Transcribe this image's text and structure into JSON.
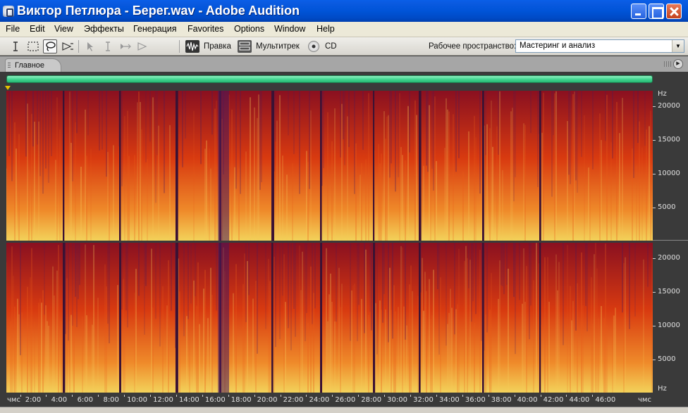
{
  "window": {
    "title": "Виктор Петлюра - Берег.wav - Adobe Audition",
    "app_icon": "adobe-audition-icon"
  },
  "menu": [
    {
      "label": "File"
    },
    {
      "label": "Edit"
    },
    {
      "label": "View"
    },
    {
      "label": "Эффекты"
    },
    {
      "label": "Генерация"
    },
    {
      "label": "Favorites"
    },
    {
      "label": "Options"
    },
    {
      "label": "Window"
    },
    {
      "label": "Help"
    }
  ],
  "toolbar": {
    "tools": [
      {
        "name": "time-selection-tool-icon",
        "selected": false
      },
      {
        "name": "marquee-selection-tool-icon",
        "selected": false
      },
      {
        "name": "lasso-selection-tool-icon",
        "selected": true
      },
      {
        "name": "effects-paintbrush-tool-icon",
        "selected": false
      },
      {
        "name": "move-tool-icon",
        "selected": false
      },
      {
        "name": "hybrid-tool-icon",
        "selected": false
      },
      {
        "name": "slip-tool-icon",
        "selected": false
      },
      {
        "name": "scrub-tool-icon",
        "selected": false
      }
    ],
    "modes": {
      "edit": "Правка",
      "multitrack": "Мультитрек",
      "cd": "CD"
    },
    "workspace_label": "Рабочее пространство:",
    "workspace_value": "Мастеринг и анализ"
  },
  "panel": {
    "tab_label": "Главное"
  },
  "spectral_view": {
    "freq_unit": "Hz",
    "freq_labels": [
      "20000",
      "15000",
      "10000",
      "5000"
    ],
    "time_unit": "чмс",
    "time_labels": [
      "2:00",
      "4:00",
      "6:00",
      "8:00",
      "10:00",
      "12:00",
      "14:00",
      "16:00",
      "18:00",
      "20:00",
      "22:00",
      "24:00",
      "26:00",
      "28:00",
      "30:00",
      "32:00",
      "34:00",
      "36:00",
      "38:00",
      "40:00",
      "42:00",
      "44:00",
      "46:00"
    ],
    "colors": {
      "low": "#f3d25a",
      "mid": "#d83a10",
      "high": "#8a1020",
      "quiet": "#4a1a5a"
    }
  }
}
